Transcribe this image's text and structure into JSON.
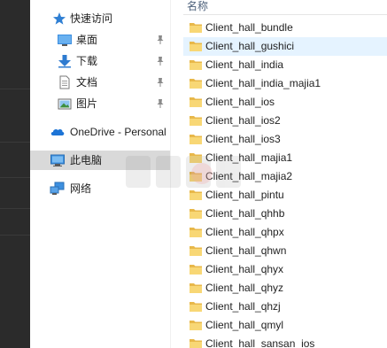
{
  "nav": {
    "quick_access": "快速访问",
    "desktop": "桌面",
    "downloads": "下载",
    "documents": "文档",
    "pictures": "图片",
    "onedrive": "OneDrive - Personal",
    "this_pc": "此电脑",
    "network": "网络"
  },
  "list": {
    "header_name": "名称",
    "items": [
      "Client_hall_bundle",
      "Client_hall_gushici",
      "Client_hall_india",
      "Client_hall_india_majia1",
      "Client_hall_ios",
      "Client_hall_ios2",
      "Client_hall_ios3",
      "Client_hall_majia1",
      "Client_hall_majia2",
      "Client_hall_pintu",
      "Client_hall_qhhb",
      "Client_hall_qhpx",
      "Client_hall_qhwn",
      "Client_hall_qhyx",
      "Client_hall_qhyz",
      "Client_hall_qhzj",
      "Client_hall_qmyl",
      "Client_hall_sansan_ios"
    ]
  },
  "colors": {
    "folder": "#f8d775",
    "selected_nav": "#d9d9d9",
    "hover_row": "#e5f3ff",
    "header_text": "#4c607a"
  }
}
